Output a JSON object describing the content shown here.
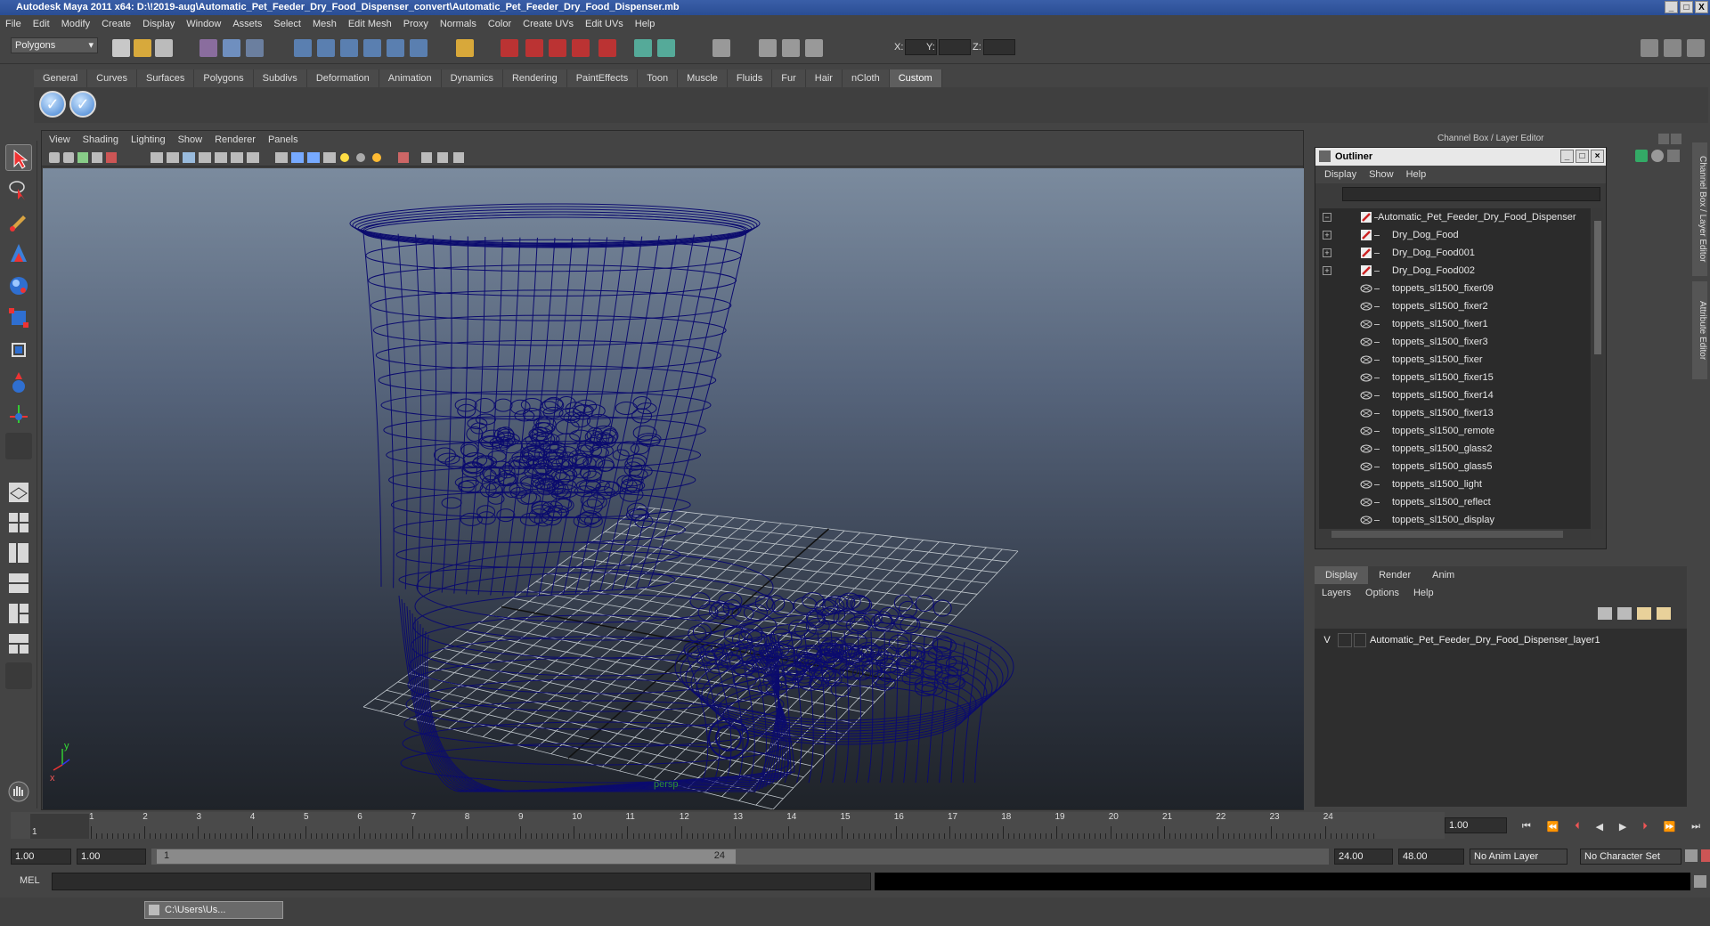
{
  "window": {
    "title": "Autodesk Maya 2011 x64: D:\\!2019-aug\\Automatic_Pet_Feeder_Dry_Food_Dispenser_convert\\Automatic_Pet_Feeder_Dry_Food_Dispenser.mb",
    "buttons": [
      "_",
      "□",
      "X"
    ]
  },
  "menubar": [
    "File",
    "Edit",
    "Modify",
    "Create",
    "Display",
    "Window",
    "Assets",
    "Select",
    "Mesh",
    "Edit Mesh",
    "Proxy",
    "Normals",
    "Color",
    "Create UVs",
    "Edit UVs",
    "Help"
  ],
  "statusline": {
    "menuset": "Polygons",
    "x_label": "X:",
    "y_label": "Y:",
    "z_label": "Z:"
  },
  "shelf": {
    "tabs": [
      "General",
      "Curves",
      "Surfaces",
      "Polygons",
      "Subdivs",
      "Deformation",
      "Animation",
      "Dynamics",
      "Rendering",
      "PaintEffects",
      "Toon",
      "Muscle",
      "Fluids",
      "Fur",
      "Hair",
      "nCloth",
      "Custom"
    ],
    "active_tab": "Custom"
  },
  "viewport": {
    "menu": [
      "View",
      "Shading",
      "Lighting",
      "Show",
      "Renderer",
      "Panels"
    ],
    "camera_label": "persp",
    "axis_x": "x",
    "axis_y": "y",
    "wire_color": "#0b0b6e"
  },
  "channel_box_title": "Channel Box / Layer Editor",
  "right_tabs": [
    "Channel Box / Layer Editor",
    "Attribute Editor"
  ],
  "outliner": {
    "title": "Outliner",
    "menu": [
      "Display",
      "Show",
      "Help"
    ],
    "items": [
      {
        "label": "Automatic_Pet_Feeder_Dry_Food_Dispenser",
        "expand": "−",
        "icon": "group-icon",
        "indent": 0
      },
      {
        "label": "Dry_Dog_Food",
        "expand": "+",
        "icon": "group-icon",
        "indent": 1
      },
      {
        "label": "Dry_Dog_Food001",
        "expand": "+",
        "icon": "group-icon",
        "indent": 1
      },
      {
        "label": "Dry_Dog_Food002",
        "expand": "+",
        "icon": "group-icon",
        "indent": 1
      },
      {
        "label": "toppets_sl1500_fixer09",
        "expand": "",
        "icon": "mesh-icon",
        "indent": 1
      },
      {
        "label": "toppets_sl1500_fixer2",
        "expand": "",
        "icon": "mesh-icon",
        "indent": 1
      },
      {
        "label": "toppets_sl1500_fixer1",
        "expand": "",
        "icon": "mesh-icon",
        "indent": 1
      },
      {
        "label": "toppets_sl1500_fixer3",
        "expand": "",
        "icon": "mesh-icon",
        "indent": 1
      },
      {
        "label": "toppets_sl1500_fixer",
        "expand": "",
        "icon": "mesh-icon",
        "indent": 1
      },
      {
        "label": "toppets_sl1500_fixer15",
        "expand": "",
        "icon": "mesh-icon",
        "indent": 1
      },
      {
        "label": "toppets_sl1500_fixer14",
        "expand": "",
        "icon": "mesh-icon",
        "indent": 1
      },
      {
        "label": "toppets_sl1500_fixer13",
        "expand": "",
        "icon": "mesh-icon",
        "indent": 1
      },
      {
        "label": "toppets_sl1500_remote",
        "expand": "",
        "icon": "mesh-icon",
        "indent": 1
      },
      {
        "label": "toppets_sl1500_glass2",
        "expand": "",
        "icon": "mesh-icon",
        "indent": 1
      },
      {
        "label": "toppets_sl1500_glass5",
        "expand": "",
        "icon": "mesh-icon",
        "indent": 1
      },
      {
        "label": "toppets_sl1500_light",
        "expand": "",
        "icon": "mesh-icon",
        "indent": 1
      },
      {
        "label": "toppets_sl1500_reflect",
        "expand": "",
        "icon": "mesh-icon",
        "indent": 1
      },
      {
        "label": "toppets_sl1500_display",
        "expand": "",
        "icon": "mesh-icon",
        "indent": 1
      }
    ]
  },
  "layer_editor": {
    "tabs": [
      "Display",
      "Render",
      "Anim"
    ],
    "active_tab": "Display",
    "menu": [
      "Layers",
      "Options",
      "Help"
    ],
    "layer": {
      "visible": "V",
      "name": "Automatic_Pet_Feeder_Dry_Food_Dispenser_layer1"
    }
  },
  "timeline": {
    "ticks": [
      "1",
      "2",
      "3",
      "4",
      "5",
      "6",
      "7",
      "8",
      "9",
      "10",
      "11",
      "12",
      "13",
      "14",
      "15",
      "16",
      "17",
      "18",
      "19",
      "20",
      "21",
      "22",
      "23",
      "24"
    ],
    "current_frame": "1.00",
    "current_marker": "1"
  },
  "range": {
    "start": "1.00",
    "playback_start": "1.00",
    "slider_start": "1",
    "slider_end": "24",
    "playback_end": "24.00",
    "end": "48.00",
    "anim_layer": "No Anim Layer",
    "character_set": "No Character Set"
  },
  "command_line": {
    "label": "MEL"
  },
  "taskbar": {
    "item": "C:\\Users\\Us..."
  }
}
